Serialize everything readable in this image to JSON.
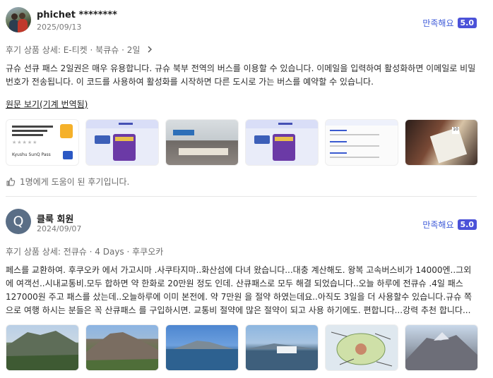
{
  "reviews": [
    {
      "reviewer": "phichet ********",
      "date": "2025/09/13",
      "rating_text": "만족해요",
      "rating_value": "5.0",
      "product": "후기 상품 상세: E-티켓 · 북큐슈 · 2일",
      "body": "규슈 선큐 패스 2일권은 매우 유용합니다. 규슈 북부 전역의 버스를 이용할 수 있습니다. 이메일을 입력하여 활성화하면 이메일로 비밀번호가 전송됩니다. 이 코드를 사용하여 활성화를 시작하면 다른 도시로 가는 버스를 예약할 수 있습니다.",
      "original_link": "원문 보기(기계 번역됨)",
      "helpful": "1명에게 도움이 된 후기입니다.",
      "thumb_texts": {
        "card_brand": "Kyushu SunQ Pass",
        "card_sub": "E-ticket",
        "pass_label": "1-day Pass",
        "list_labels": [
          "Current time",
          "Date of use",
          "Available Period"
        ]
      }
    },
    {
      "reviewer": "클룩 회원",
      "avatar_letter": "Q",
      "date": "2024/09/07",
      "rating_text": "만족해요",
      "rating_value": "5.0",
      "product": "후기 상품 상세: 전큐슈 · 4 Days · 후쿠오카",
      "body": "페스를 교환하여. 후쿠오카 에서 가고시마 .사쿠타지마..화산섬에 다녀 왔습니다...대충 계산해도. 왕복 고속버스비가 14000엔..그외에 여객선..시내교통비.모두 합하면 약 한화로 20만원 정도 인데. 산큐패스로 모두 해결 되었습니다..오늘 하루에 전큐슈 .4일 패스 127000원 주고 패스를 샀는데..오늘하루에 이미 본전에. 약 7만원 을 절약 하였는데요..아직도 3일을 더 사용할수 있습니다.규슈 쪽으로 여행 하시는 분들은 꼭 산큐패스 를 구입하시면. 교통비 절약에 많은 절약이 되고 사용 하기에도. 편합니다...강력 추천 합니다..."
    }
  ]
}
